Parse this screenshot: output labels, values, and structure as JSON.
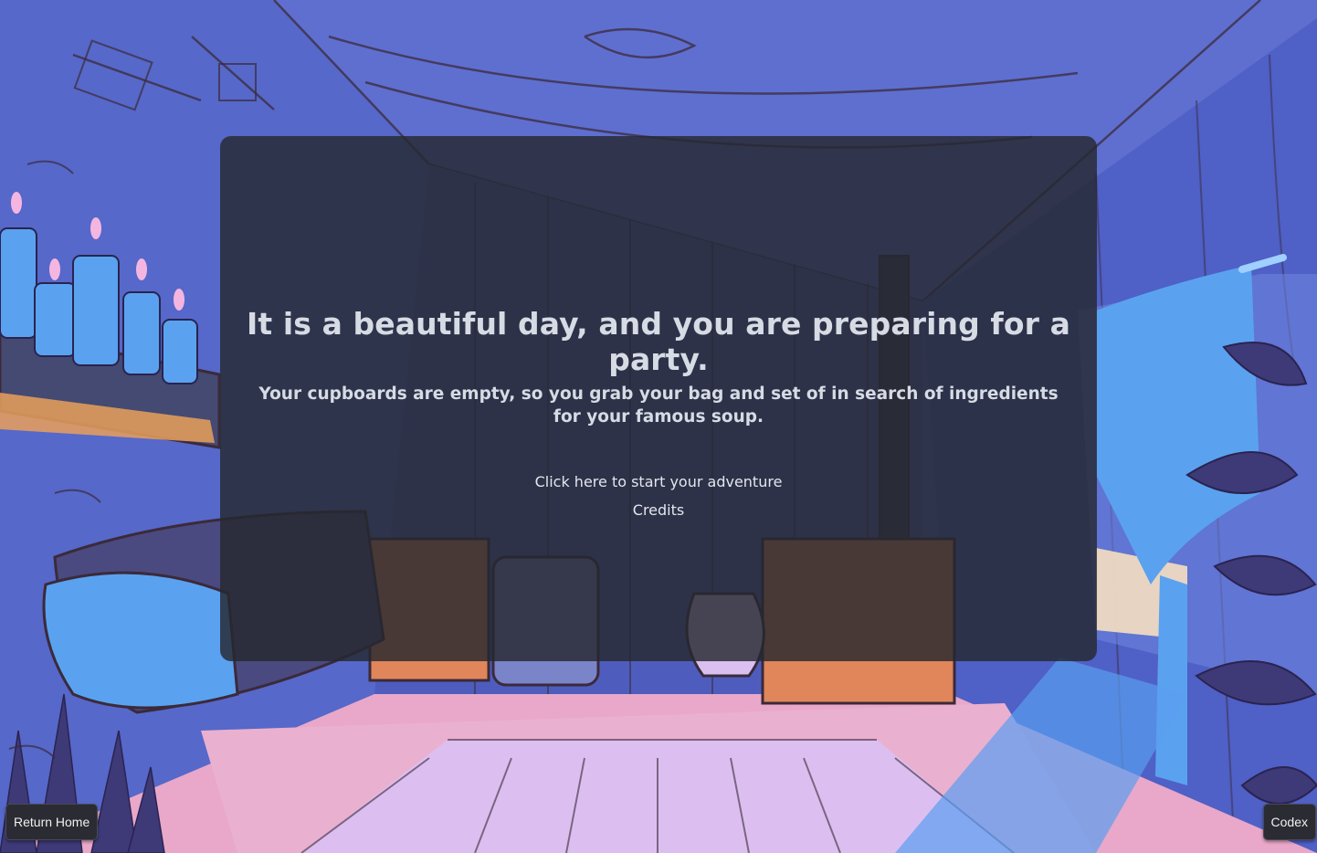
{
  "colors": {
    "background_blue": "#5668c9",
    "wood_line": "#3b2a3a",
    "floor_pink": "#e9a8c9",
    "floor_lilac": "#dcbff0",
    "candle_blue": "#5aa2f0",
    "panel_bg": "rgba(38, 40, 48, 0.82)",
    "button_bg": "#2b2b33"
  },
  "intro": {
    "headline": "It is a beautiful day, and you are preparing for a party.",
    "subline": "Your cupboards are empty, so you grab your bag and set of in search of ingredients for your famous soup.",
    "start_link": "Click here to start your adventure",
    "credits_link": "Credits"
  },
  "footer": {
    "return_home_label": "Return Home",
    "codex_label": "Codex"
  }
}
